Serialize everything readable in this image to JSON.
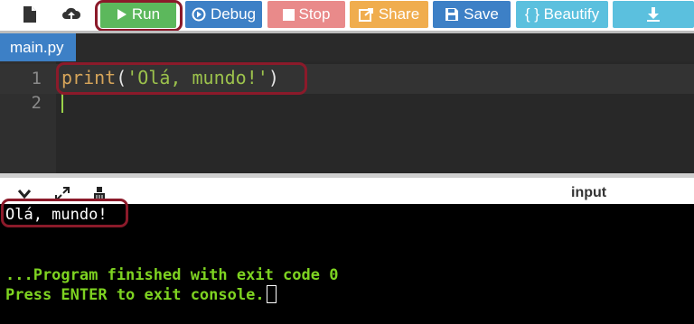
{
  "toolbar": {
    "new_file_icon": "file-icon",
    "upload_icon": "upload-cloud-icon",
    "buttons": [
      {
        "label": "Run",
        "icon": "play-icon",
        "color": "#5cb85c"
      },
      {
        "label": "Debug",
        "icon": "debug-icon",
        "color": "#3d80c6"
      },
      {
        "label": "Stop",
        "icon": "stop-icon",
        "color": "#e98a8a"
      },
      {
        "label": "Share",
        "icon": "share-icon",
        "color": "#f0ad4e"
      },
      {
        "label": "Save",
        "icon": "save-icon",
        "color": "#3d80c6"
      },
      {
        "label": "{ } Beautify",
        "color": "#5bc0de"
      },
      {
        "label": "",
        "icon": "download-icon",
        "color": "#5bc0de"
      }
    ]
  },
  "file_tab": {
    "label": "main.py"
  },
  "editor": {
    "line_numbers": [
      "1",
      "2"
    ],
    "code": {
      "keyword": "print",
      "open": "(",
      "string": "'Olá, mundo!'",
      "close": ")"
    }
  },
  "console": {
    "icons": [
      "chevron-down-icon",
      "expand-icon",
      "clear-console-icon"
    ],
    "input_label": "input",
    "output_line": "Olá, mundo!",
    "finished_line": "...Program finished with exit code 0",
    "press_enter_line": "Press ENTER to exit console."
  },
  "annotation_color": "#8b1a2a"
}
